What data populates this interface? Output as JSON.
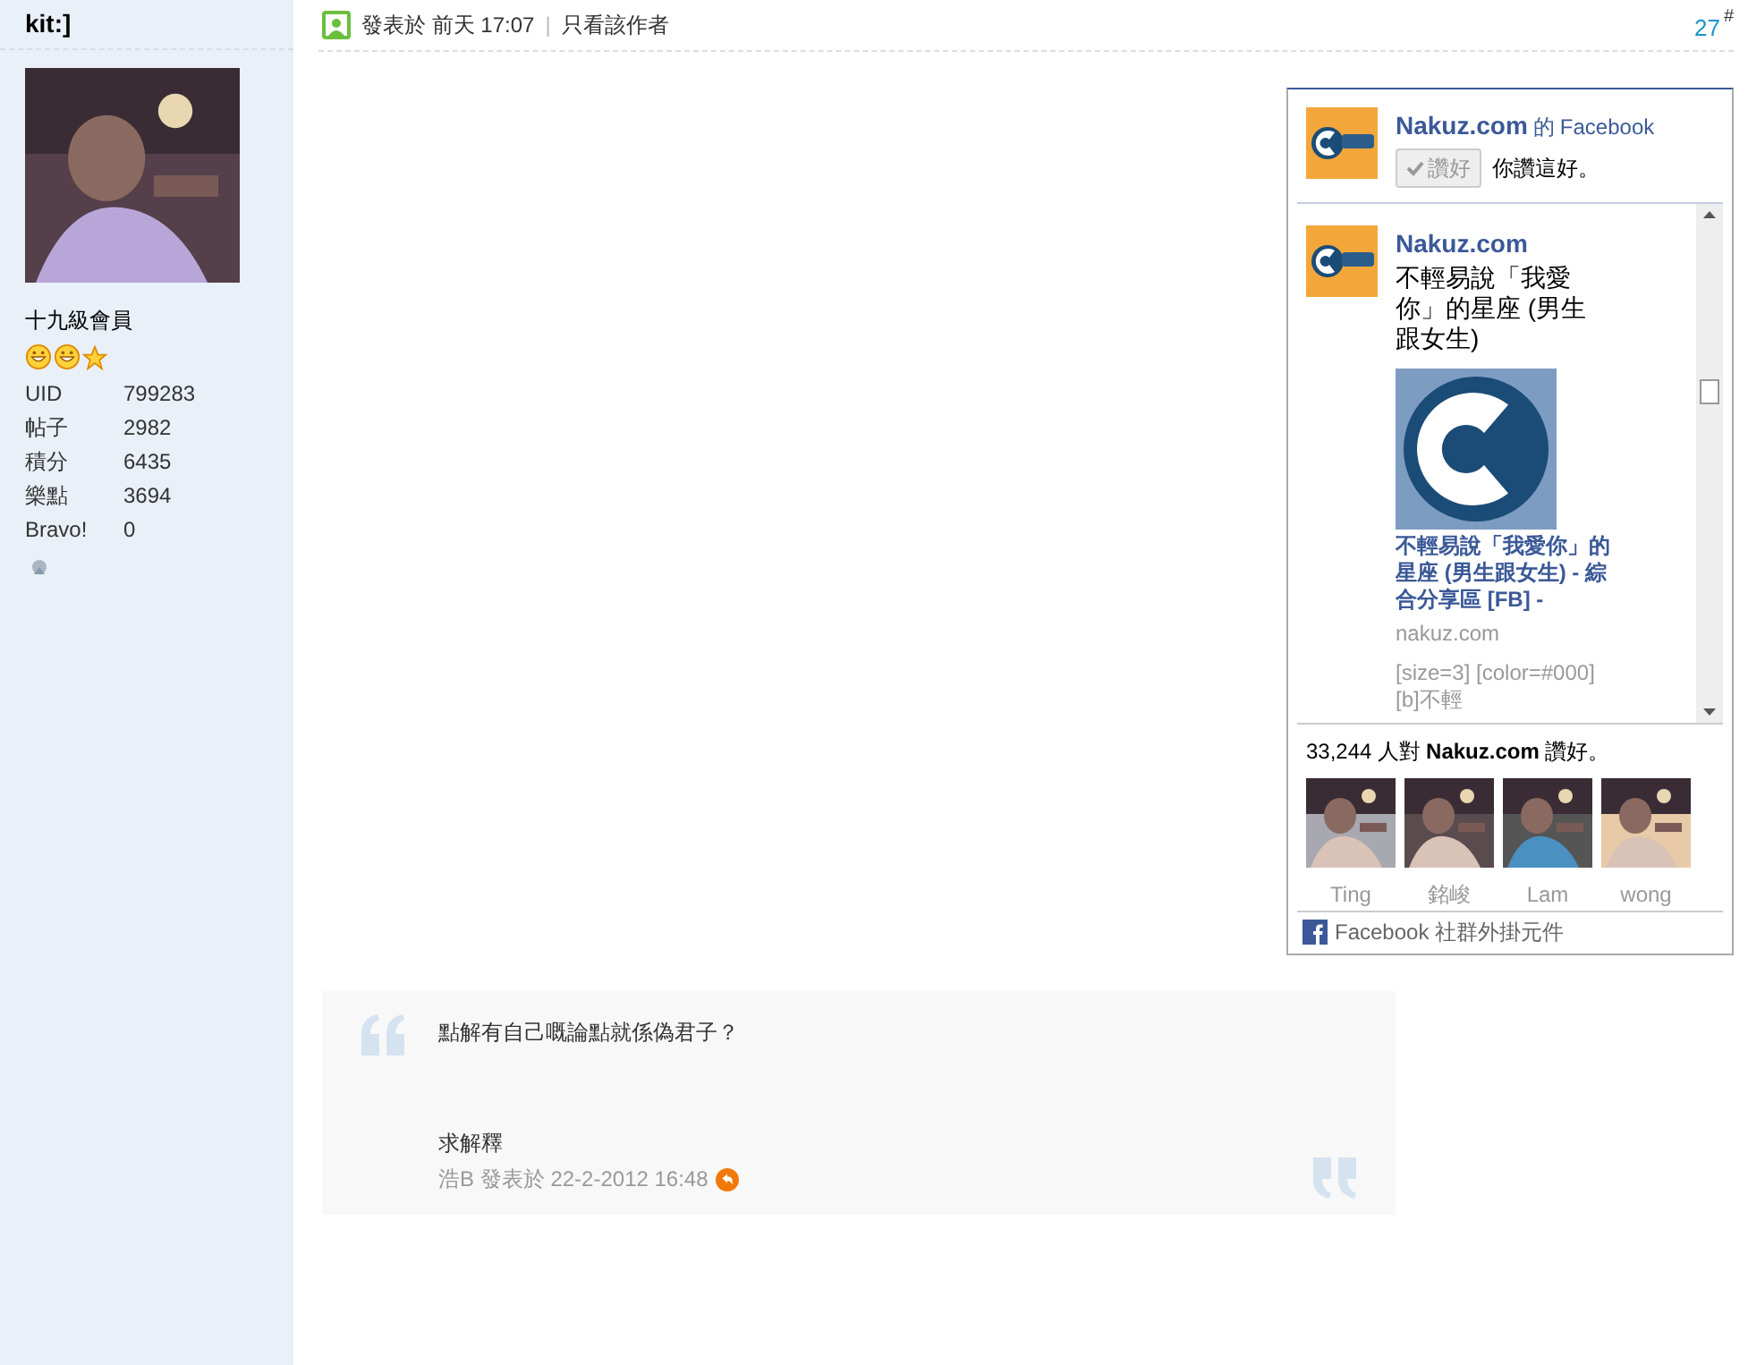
{
  "author": {
    "name": "kit:]",
    "rank": "十九級會員",
    "stats": [
      {
        "label": "UID",
        "value": "799283"
      },
      {
        "label": "帖子",
        "value": "2982"
      },
      {
        "label": "積分",
        "value": "6435"
      },
      {
        "label": "樂點",
        "value": "3694"
      },
      {
        "label": "Bravo!",
        "value": "0"
      }
    ]
  },
  "post_header": {
    "posted": "發表於",
    "time": "前天 17:07",
    "separator": "|",
    "author_only": "只看該作者",
    "floor": "27",
    "floor_mark": "#"
  },
  "facebook_box": {
    "page_name": "Nakuz.com",
    "of": "的",
    "facebook": "Facebook",
    "like_button": {
      "label": "讚好",
      "checked": true
    },
    "like_note": "你讚這好。",
    "feed": {
      "page_name": "Nakuz.com",
      "status": "不輕易說「我愛你」的星座 (男生跟女生)",
      "link_title": "不輕易說「我愛你」的星座 (男生跟女生) - 綜合分享區 [FB] -",
      "domain": "nakuz.com",
      "excerpt": "[size=3] [color=#000][b]不輕"
    },
    "count_prefix": "33,244 人對",
    "count_page": "Nakuz.com",
    "count_suffix": "讚好。",
    "fans": [
      {
        "name": "Ting"
      },
      {
        "name": "銘峻"
      },
      {
        "name": "Lam"
      },
      {
        "name": "wong"
      }
    ],
    "footer": "Facebook 社群外掛元件"
  },
  "quote": {
    "lines": [
      "點解有自己嘅論點就係偽君子？",
      "求解釋"
    ],
    "author": "浩B",
    "posted": "發表於",
    "time": "22-2-2012 16:48"
  }
}
